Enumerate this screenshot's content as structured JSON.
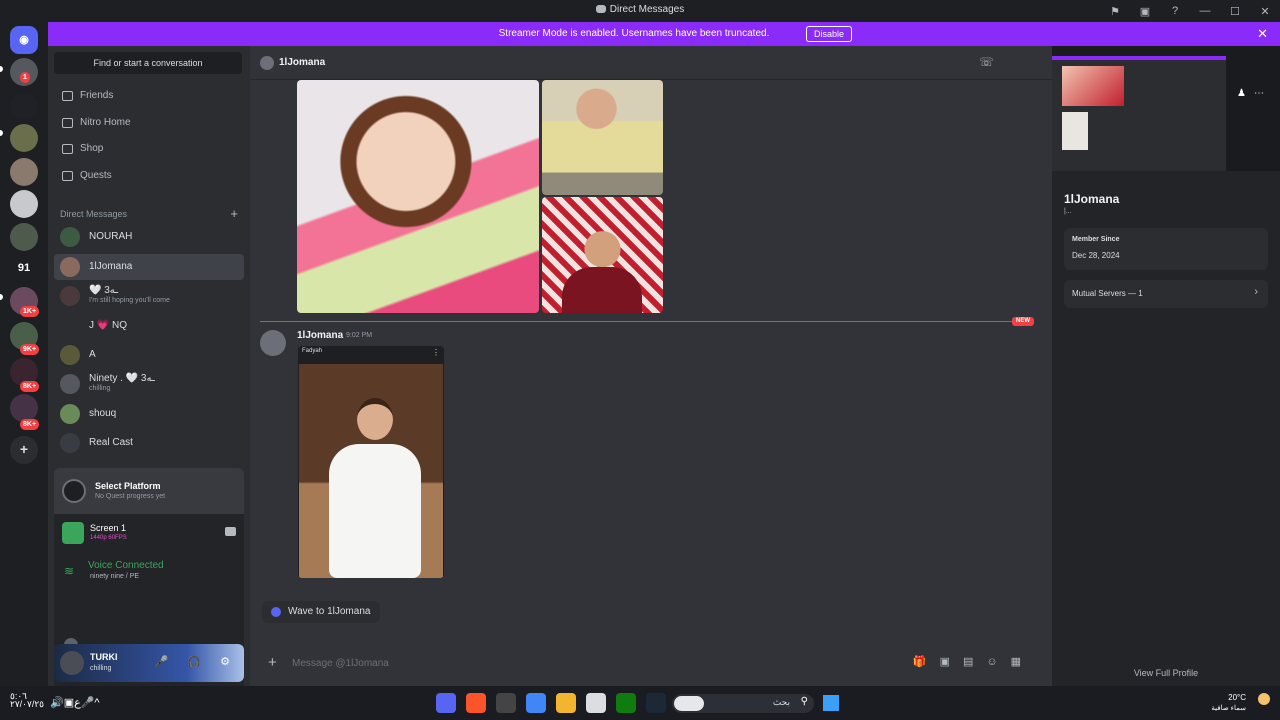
{
  "window": {
    "title": "Direct Messages",
    "controls": [
      "⚑",
      "▣",
      "?",
      "—",
      "☐",
      "✕"
    ]
  },
  "banner": {
    "text": "Streamer Mode is enabled. Usernames have been truncated.",
    "button": "Disable",
    "close": "✕"
  },
  "servers": {
    "badges": [
      "1",
      "1K+",
      "9K+",
      "8K+",
      "8K+"
    ],
    "numbered_label": "91",
    "add": "+"
  },
  "sidebar": {
    "search_placeholder": "Find or start a conversation",
    "nav": [
      {
        "label": "Friends",
        "icon": "friends-icon"
      },
      {
        "label": "Nitro Home",
        "icon": "nitro-icon"
      },
      {
        "label": "Shop",
        "icon": "shop-icon"
      },
      {
        "label": "Quests",
        "icon": "quests-icon"
      }
    ],
    "dm_header": "Direct Messages",
    "dm_add": "+",
    "dms": [
      {
        "name": "NOURAH",
        "sub": ""
      },
      {
        "name": "1lJomana",
        "sub": ""
      },
      {
        "name": "🤍 ـه3",
        "sub": "I'm still hoping you'll come"
      },
      {
        "name": "J 💗 NQ",
        "sub": ""
      },
      {
        "name": "A",
        "sub": ""
      },
      {
        "name": "Ninety . 🤍 ـه3",
        "sub": "chilling"
      },
      {
        "name": "shouq",
        "sub": ""
      },
      {
        "name": "Real Cast",
        "sub": ""
      }
    ]
  },
  "quest": {
    "title": "Select Platform",
    "subtitle": "No Quest progress yet"
  },
  "voice": {
    "screen_title": "Screen 1",
    "screen_sub": "1440p 60FPS",
    "status": "Voice Connected",
    "channel": "ninety nine / PE",
    "actions": [
      "▨",
      "✕",
      "⬚",
      "✎"
    ]
  },
  "user": {
    "name": "TURKI",
    "status": "chilling",
    "controls": "🎤 🎧 ⚙"
  },
  "chat": {
    "recipient": "1lJomana",
    "new_tag": "NEW",
    "message": {
      "author": "1lJomana",
      "time": "9:02 PM",
      "embed_label": "Fadyah"
    },
    "wave": "Wave to 1lJomana",
    "composer_placeholder": "Message @1lJomana"
  },
  "profile": {
    "name": "1lJomana",
    "sub": "|...",
    "member_since_label": "Member Since",
    "member_since": "Dec 28, 2024",
    "mutual": "Mutual Servers — 1",
    "view_full": "View Full Profile"
  },
  "taskbar": {
    "clock_left": "٥:٠٦\n٢٧/٠٧/٢٥",
    "search_text": "بحث",
    "temperature": "20°C",
    "weather": "سماء صافية"
  },
  "colors": {
    "accent": "#5865f2",
    "banner": "#8b2bfa",
    "online": "#3ba55c",
    "danger": "#f23f42"
  }
}
